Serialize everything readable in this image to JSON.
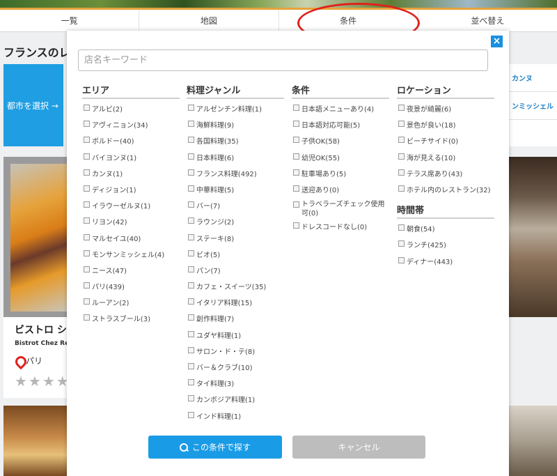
{
  "tabs": [
    "一覧",
    "地図",
    "条件",
    "並べ替え"
  ],
  "background": {
    "heading": "フランスのレ",
    "city_button": "都市を選択 →",
    "right_links": [
      "カンヌ",
      "ンミッシェル"
    ],
    "card": {
      "title": "ビストロ シ",
      "subtitle": "Bistrot Chez Rei",
      "location": "パリ",
      "stars": "★★★★"
    }
  },
  "modal": {
    "close": "×",
    "keyword_placeholder": "店名キーワード",
    "area": {
      "title": "エリア",
      "options": [
        "アルビ(2)",
        "アヴィニョン(34)",
        "ボルドー(40)",
        "バイヨンヌ(1)",
        "カンヌ(1)",
        "ディジョン(1)",
        "イラウーゼルヌ(1)",
        "リヨン(42)",
        "マルセイユ(40)",
        "モンサンミッシェル(4)",
        "ニース(47)",
        "パリ(439)",
        "ルーアン(2)",
        "ストラスブール(3)"
      ]
    },
    "genre": {
      "title": "料理ジャンル",
      "options": [
        "アルゼンチン料理(1)",
        "海鮮料理(9)",
        "各国料理(35)",
        "日本料理(6)",
        "フランス料理(492)",
        "中華料理(5)",
        "バー(7)",
        "ラウンジ(2)",
        "ステーキ(8)",
        "ビオ(5)",
        "パン(7)",
        "カフェ・スイーツ(35)",
        "イタリア料理(15)",
        "創作料理(7)",
        "ユダヤ料理(1)",
        "サロン・ド・テ(8)",
        "バー＆クラブ(10)",
        "タイ料理(3)",
        "カンボジア料理(1)",
        "インド料理(1)"
      ]
    },
    "conditions": {
      "title": "条件",
      "options": [
        "日本語メニューあり(4)",
        "日本語対応可能(5)",
        "子供OK(58)",
        "幼児OK(55)",
        "駐車場あり(5)",
        "送迎あり(0)",
        "トラベラーズチェック使用可(0)",
        "ドレスコードなし(0)"
      ]
    },
    "location": {
      "title": "ロケーション",
      "options": [
        "夜景が綺麗(6)",
        "景色が良い(18)",
        "ビーチサイド(0)",
        "海が見える(10)",
        "テラス席あり(43)",
        "ホテル内のレストラン(32)"
      ]
    },
    "time": {
      "title": "時間帯",
      "options": [
        "朝食(54)",
        "ランチ(425)",
        "ディナー(443)"
      ]
    },
    "search_button": "この条件で探す",
    "cancel_button": "キャンセル"
  }
}
